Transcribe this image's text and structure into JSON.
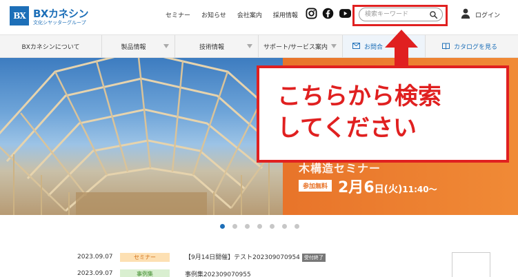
{
  "brand": {
    "mark": "BX",
    "name": "BXカネシン",
    "sub": "文化シヤッターグループ"
  },
  "topnav": [
    "セミナー",
    "お知らせ",
    "会社案内",
    "採用情報"
  ],
  "search": {
    "placeholder": "検索キーワード"
  },
  "login": "ログイン",
  "mainnav": [
    {
      "label": "BXカネシンについて"
    },
    {
      "label": "製品情報"
    },
    {
      "label": "技術情報"
    },
    {
      "label": "サポート/サービス案内"
    },
    {
      "label": "お問合"
    },
    {
      "label": "カタログを見る"
    }
  ],
  "hero": {
    "partial_title": "木構造セミナー",
    "badge": "参加無料",
    "date_month": "2月",
    "date_day": "6",
    "date_day_suffix": "日",
    "date_weekday": "(火)",
    "date_time": "11:40～"
  },
  "callout": {
    "text": "こちらから検索\nしてください"
  },
  "carousel": {
    "count": 7,
    "active": 0
  },
  "news": [
    {
      "date": "2023.09.07",
      "category": "セミナー",
      "title": "【9月14日開催】テスト202309070954",
      "tag": "受付終了"
    },
    {
      "date": "2023.09.07",
      "category": "事例集",
      "title": "事例集202309070955",
      "tag": ""
    }
  ],
  "colors": {
    "brand": "#1d6fb8",
    "annotation": "#e02020",
    "hero_orange": "#e8742a"
  }
}
